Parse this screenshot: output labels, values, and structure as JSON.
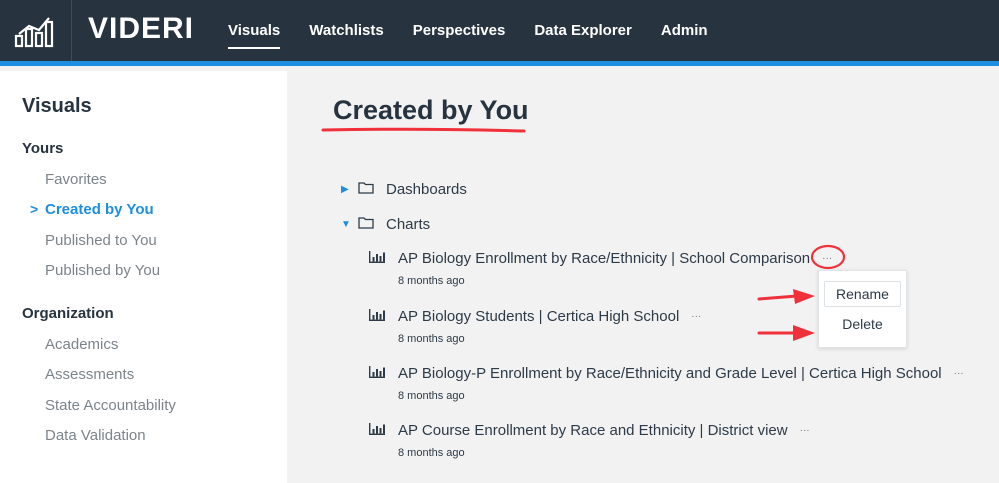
{
  "app": {
    "brand": "VIDERI",
    "logo_icon": "bar-chart-logo-icon",
    "nav": [
      {
        "label": "Visuals",
        "active": true
      },
      {
        "label": "Watchlists"
      },
      {
        "label": "Perspectives"
      },
      {
        "label": "Data Explorer"
      },
      {
        "label": "Admin"
      }
    ]
  },
  "sidebar": {
    "title": "Visuals",
    "sections": [
      {
        "heading": "Yours",
        "items": [
          {
            "label": "Favorites"
          },
          {
            "label": "Created by You",
            "active": true
          },
          {
            "label": "Published to You"
          },
          {
            "label": "Published by You"
          }
        ]
      },
      {
        "heading": "Organization",
        "items": [
          {
            "label": "Academics"
          },
          {
            "label": "Assessments"
          },
          {
            "label": "State Accountability"
          },
          {
            "label": "Data Validation"
          }
        ]
      }
    ]
  },
  "main": {
    "title": "Created by You",
    "folders": [
      {
        "label": "Dashboards",
        "expanded": false
      },
      {
        "label": "Charts",
        "expanded": true
      }
    ],
    "charts": [
      {
        "title": "AP Biology Enrollment by Race/Ethnicity | School Comparison",
        "meta": "8 months ago",
        "more": "···"
      },
      {
        "title": "AP Biology Students | Certica High School",
        "meta": "8 months ago",
        "more": "···"
      },
      {
        "title": "AP Biology-P Enrollment by Race/Ethnicity and Grade Level | Certica High School",
        "meta": "8 months ago",
        "more": "···"
      },
      {
        "title": "AP Course Enrollment by Race and Ethnicity | District view",
        "meta": "8 months ago",
        "more": "···"
      }
    ],
    "context_menu": {
      "items": [
        {
          "label": "Rename"
        },
        {
          "label": "Delete"
        }
      ]
    }
  },
  "colors": {
    "nav_bg": "#27333f",
    "accent": "#1e8ee0",
    "annotation": "#f0303a"
  }
}
